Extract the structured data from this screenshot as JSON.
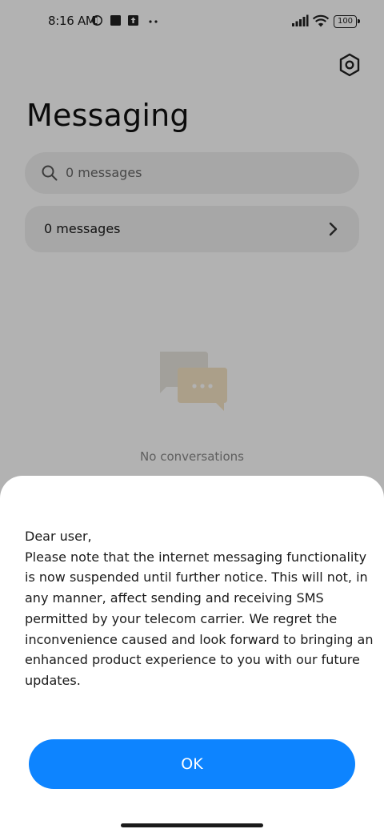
{
  "status_bar": {
    "time": "8:16 AM",
    "battery": "100",
    "icons": [
      "data-saver-icon",
      "stop-square-icon",
      "upload-icon",
      "more-dots-icon",
      "signal-icon",
      "wifi-icon",
      "battery-icon"
    ]
  },
  "header": {
    "title": "Messaging",
    "settings_icon": "settings-hexagon-icon"
  },
  "search": {
    "placeholder": "0 messages",
    "icon": "search-icon"
  },
  "message_row": {
    "label": "0 messages",
    "icon": "chevron-right-icon"
  },
  "empty_state": {
    "text": "No conversations",
    "icon": "chat-bubbles-icon"
  },
  "dialog": {
    "greeting": "Dear user,",
    "body": "Please note that the internet messaging functionality is now suspended until further notice. This will not, in any manner, affect sending and receiving SMS permitted by your telecom carrier. We regret the inconvenience caused and look forward to bringing an enhanced product experience to you with our future updates.",
    "ok_label": "OK"
  },
  "colors": {
    "accent": "#0d84ff",
    "overlay": "rgba(0,0,0,0.30)",
    "card": "#f0f0f0"
  }
}
